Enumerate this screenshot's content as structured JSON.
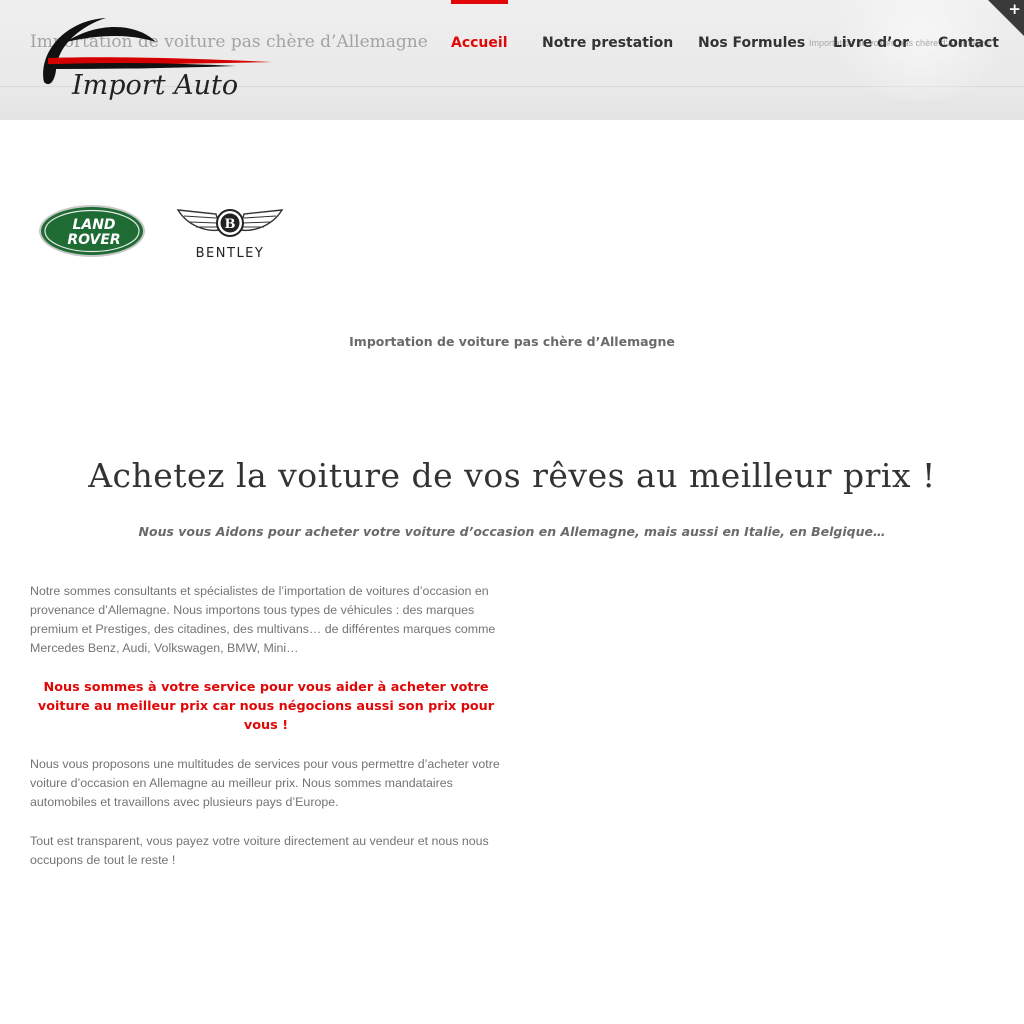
{
  "header": {
    "tagline": "Importation de voiture pas chère d’Allemagne",
    "tagline_small": "Importation de voiture pas chère d’Allemagne",
    "logo_text": "Import Auto",
    "nav": [
      {
        "label": "Accueil",
        "active": true
      },
      {
        "label": "Notre prestation",
        "active": false
      },
      {
        "label": "Nos Formules",
        "active": false
      },
      {
        "label": "Livre d’or",
        "active": false
      },
      {
        "label": "Contact",
        "active": false
      }
    ],
    "corner_icon": "+"
  },
  "brands": {
    "landrover_line1": "LAND",
    "landrover_line2": "ROVER",
    "bentley": "BENTLEY",
    "bentley_badge": "B"
  },
  "main": {
    "subtitle": "Importation de voiture pas chère d’Allemagne",
    "headline": "Achetez la voiture de vos rêves au meilleur prix !",
    "intro": "Nous vous Aidons pour acheter votre voiture d’occasion en Allemagne, mais aussi en Italie, en Belgique…",
    "paragraphs": [
      "Notre sommes consultants et spécialistes de l’importation de voitures d’occasion en provenance d’Allemagne. Nous importons tous types de véhicules : des marques premium et Prestiges, des citadines, des multivans… de différentes marques comme Mercedes Benz, Audi, Volkswagen, BMW, Mini…",
      "Nous sommes à votre service pour vous aider à acheter votre voiture au meilleur prix car nous négocions aussi son prix pour vous !",
      "Nous vous proposons une multitudes de services pour vous permettre d’acheter votre voiture d’occasion en Allemagne au meilleur prix. Nous sommes mandataires automobiles et travaillons avec plusieurs pays d’Europe.",
      "Tout est transparent, vous payez votre voiture directement au vendeur et nous nous occupons de tout le reste !"
    ]
  },
  "colors": {
    "accent": "#e10707",
    "nav_text": "#333333",
    "body_text": "#747474",
    "header_bg": "#ececec",
    "landrover_green": "#1e6b34"
  }
}
